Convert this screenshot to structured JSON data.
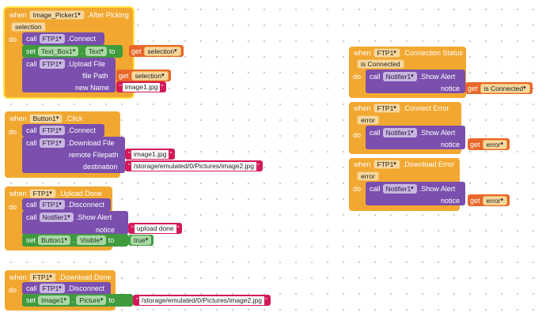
{
  "common": {
    "when": "when",
    "do": "do",
    "call": "call",
    "set": "set",
    "get": "get",
    "to": "to"
  },
  "b1": {
    "component": "Image_Picker1",
    "event": ".After Picking",
    "param": "selection",
    "s1_comp": "FTP1",
    "s1_method": ".Connect",
    "s2_comp": "Text_Box1",
    "s2_prop": "Text",
    "s2_var": "selection",
    "s3_comp": "FTP1",
    "s3_method": ".Upload File",
    "arg1_label": "file Path",
    "arg1_var": "selection",
    "arg2_label": "new Name",
    "arg2_val": "image1.jpg"
  },
  "b2": {
    "component": "Button1",
    "event": ".Click",
    "s1_comp": "FTP1",
    "s1_method": ".Connect",
    "s2_comp": "FTP1",
    "s2_method": ".Download File",
    "arg1_label": "remote Filepath",
    "arg1_val": "image1.jpg",
    "arg2_label": "destination",
    "arg2_val": "/storage/emulated/0/Pictures/image2.jpg"
  },
  "b3": {
    "component": "FTP1",
    "event": ".Upload Done",
    "s1_comp": "FTP1",
    "s1_method": ".Disconnect",
    "s2_comp": "Notifier1",
    "s2_method": ".Show Alert",
    "arg1_label": "notice",
    "arg1_val": "upload done",
    "s3_comp": "Button1",
    "s3_prop": "Visible",
    "s3_val": "true"
  },
  "b4": {
    "component": "FTP1",
    "event": ".Download Done",
    "s1_comp": "FTP1",
    "s1_method": ".Disconnect",
    "s2_comp": "Image1",
    "s2_prop": "Picture",
    "s2_val": "/storage/emulated/0/Pictures/image2.jpg"
  },
  "b5": {
    "component": "FTP1",
    "event": ".Connection Status",
    "param": "is Connected",
    "s1_comp": "Notifier1",
    "s1_method": ".Show Alert",
    "arg1_label": "notice",
    "arg1_var": "is Connected"
  },
  "b6": {
    "component": "FTP1",
    "event": ".Connect Error",
    "param": "error",
    "s1_comp": "Notifier1",
    "s1_method": ".Show Alert",
    "arg1_label": "notice",
    "arg1_var": "error"
  },
  "b7": {
    "component": "FTP1",
    "event": ".Download Error",
    "param": "error",
    "s1_comp": "Notifier1",
    "s1_method": ".Show Alert",
    "arg1_label": "notice",
    "arg1_var": "error"
  },
  "colors": {
    "event": "#f2a830",
    "method": "#7a4fad",
    "setter": "#3f9b3e",
    "getter": "#e8672a",
    "text": "#d4195a",
    "selection": "#ffe23b"
  }
}
